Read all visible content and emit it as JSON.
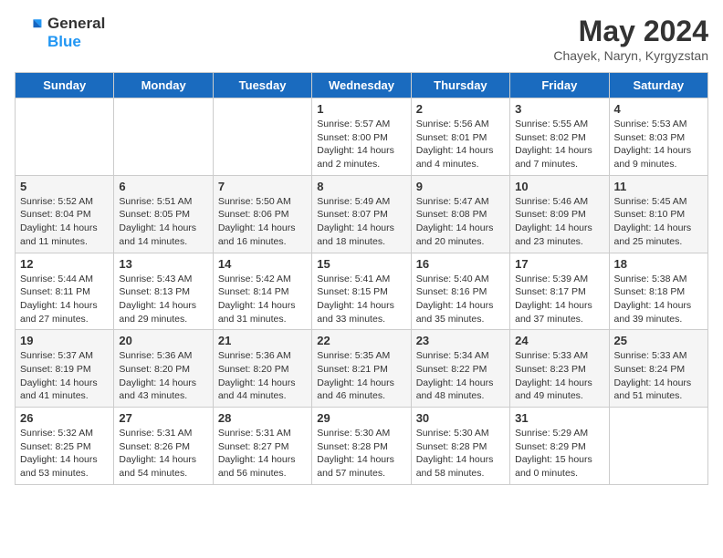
{
  "logo": {
    "text_general": "General",
    "text_blue": "Blue"
  },
  "title": "May 2024",
  "subtitle": "Chayek, Naryn, Kyrgyzstan",
  "days_of_week": [
    "Sunday",
    "Monday",
    "Tuesday",
    "Wednesday",
    "Thursday",
    "Friday",
    "Saturday"
  ],
  "weeks": [
    [
      {
        "day": "",
        "info": ""
      },
      {
        "day": "",
        "info": ""
      },
      {
        "day": "",
        "info": ""
      },
      {
        "day": "1",
        "info": "Sunrise: 5:57 AM\nSunset: 8:00 PM\nDaylight: 14 hours\nand 2 minutes."
      },
      {
        "day": "2",
        "info": "Sunrise: 5:56 AM\nSunset: 8:01 PM\nDaylight: 14 hours\nand 4 minutes."
      },
      {
        "day": "3",
        "info": "Sunrise: 5:55 AM\nSunset: 8:02 PM\nDaylight: 14 hours\nand 7 minutes."
      },
      {
        "day": "4",
        "info": "Sunrise: 5:53 AM\nSunset: 8:03 PM\nDaylight: 14 hours\nand 9 minutes."
      }
    ],
    [
      {
        "day": "5",
        "info": "Sunrise: 5:52 AM\nSunset: 8:04 PM\nDaylight: 14 hours\nand 11 minutes."
      },
      {
        "day": "6",
        "info": "Sunrise: 5:51 AM\nSunset: 8:05 PM\nDaylight: 14 hours\nand 14 minutes."
      },
      {
        "day": "7",
        "info": "Sunrise: 5:50 AM\nSunset: 8:06 PM\nDaylight: 14 hours\nand 16 minutes."
      },
      {
        "day": "8",
        "info": "Sunrise: 5:49 AM\nSunset: 8:07 PM\nDaylight: 14 hours\nand 18 minutes."
      },
      {
        "day": "9",
        "info": "Sunrise: 5:47 AM\nSunset: 8:08 PM\nDaylight: 14 hours\nand 20 minutes."
      },
      {
        "day": "10",
        "info": "Sunrise: 5:46 AM\nSunset: 8:09 PM\nDaylight: 14 hours\nand 23 minutes."
      },
      {
        "day": "11",
        "info": "Sunrise: 5:45 AM\nSunset: 8:10 PM\nDaylight: 14 hours\nand 25 minutes."
      }
    ],
    [
      {
        "day": "12",
        "info": "Sunrise: 5:44 AM\nSunset: 8:11 PM\nDaylight: 14 hours\nand 27 minutes."
      },
      {
        "day": "13",
        "info": "Sunrise: 5:43 AM\nSunset: 8:13 PM\nDaylight: 14 hours\nand 29 minutes."
      },
      {
        "day": "14",
        "info": "Sunrise: 5:42 AM\nSunset: 8:14 PM\nDaylight: 14 hours\nand 31 minutes."
      },
      {
        "day": "15",
        "info": "Sunrise: 5:41 AM\nSunset: 8:15 PM\nDaylight: 14 hours\nand 33 minutes."
      },
      {
        "day": "16",
        "info": "Sunrise: 5:40 AM\nSunset: 8:16 PM\nDaylight: 14 hours\nand 35 minutes."
      },
      {
        "day": "17",
        "info": "Sunrise: 5:39 AM\nSunset: 8:17 PM\nDaylight: 14 hours\nand 37 minutes."
      },
      {
        "day": "18",
        "info": "Sunrise: 5:38 AM\nSunset: 8:18 PM\nDaylight: 14 hours\nand 39 minutes."
      }
    ],
    [
      {
        "day": "19",
        "info": "Sunrise: 5:37 AM\nSunset: 8:19 PM\nDaylight: 14 hours\nand 41 minutes."
      },
      {
        "day": "20",
        "info": "Sunrise: 5:36 AM\nSunset: 8:20 PM\nDaylight: 14 hours\nand 43 minutes."
      },
      {
        "day": "21",
        "info": "Sunrise: 5:36 AM\nSunset: 8:20 PM\nDaylight: 14 hours\nand 44 minutes."
      },
      {
        "day": "22",
        "info": "Sunrise: 5:35 AM\nSunset: 8:21 PM\nDaylight: 14 hours\nand 46 minutes."
      },
      {
        "day": "23",
        "info": "Sunrise: 5:34 AM\nSunset: 8:22 PM\nDaylight: 14 hours\nand 48 minutes."
      },
      {
        "day": "24",
        "info": "Sunrise: 5:33 AM\nSunset: 8:23 PM\nDaylight: 14 hours\nand 49 minutes."
      },
      {
        "day": "25",
        "info": "Sunrise: 5:33 AM\nSunset: 8:24 PM\nDaylight: 14 hours\nand 51 minutes."
      }
    ],
    [
      {
        "day": "26",
        "info": "Sunrise: 5:32 AM\nSunset: 8:25 PM\nDaylight: 14 hours\nand 53 minutes."
      },
      {
        "day": "27",
        "info": "Sunrise: 5:31 AM\nSunset: 8:26 PM\nDaylight: 14 hours\nand 54 minutes."
      },
      {
        "day": "28",
        "info": "Sunrise: 5:31 AM\nSunset: 8:27 PM\nDaylight: 14 hours\nand 56 minutes."
      },
      {
        "day": "29",
        "info": "Sunrise: 5:30 AM\nSunset: 8:28 PM\nDaylight: 14 hours\nand 57 minutes."
      },
      {
        "day": "30",
        "info": "Sunrise: 5:30 AM\nSunset: 8:28 PM\nDaylight: 14 hours\nand 58 minutes."
      },
      {
        "day": "31",
        "info": "Sunrise: 5:29 AM\nSunset: 8:29 PM\nDaylight: 15 hours\nand 0 minutes."
      },
      {
        "day": "",
        "info": ""
      }
    ]
  ]
}
